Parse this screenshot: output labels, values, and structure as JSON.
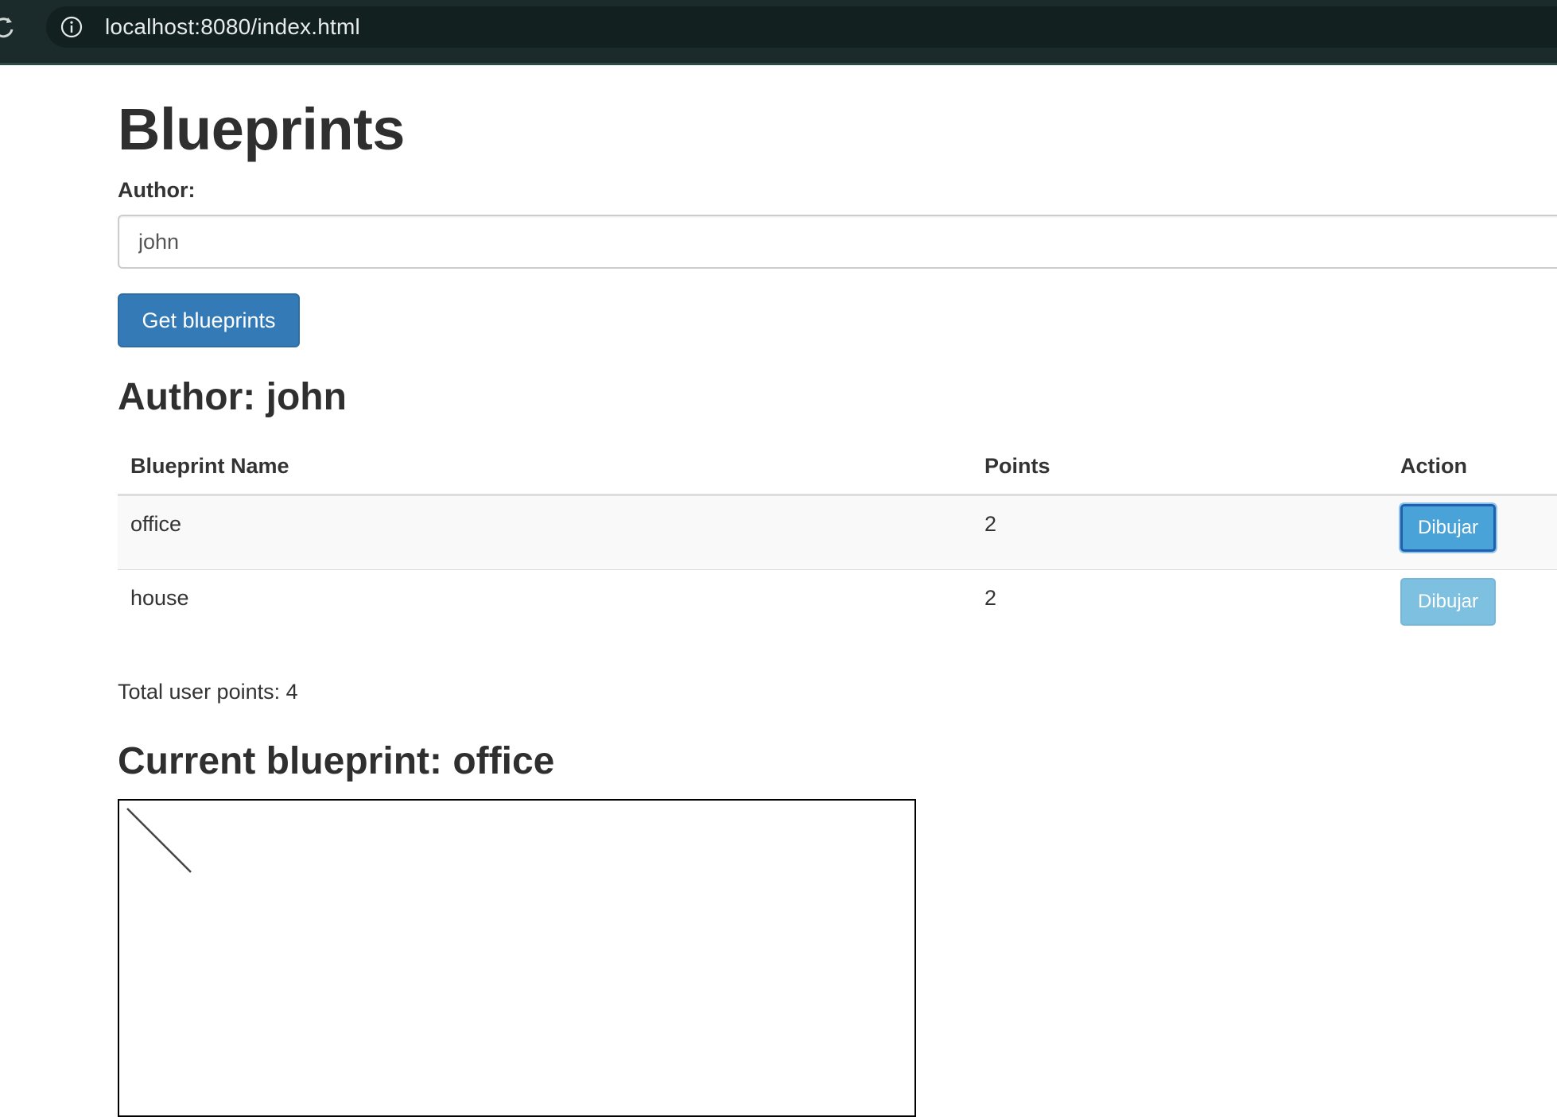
{
  "browser": {
    "url": "localhost:8080/index.html"
  },
  "page": {
    "title": "Blueprints",
    "author_label": "Author:",
    "author_input_value": "john",
    "get_button_label": "Get blueprints",
    "author_heading": "Author: john"
  },
  "table": {
    "headers": [
      "Blueprint Name",
      "Points",
      "Action"
    ],
    "rows": [
      {
        "name": "office",
        "points": "2",
        "action": "Dibujar",
        "active": true
      },
      {
        "name": "house",
        "points": "2",
        "action": "Dibujar",
        "active": false
      }
    ]
  },
  "summary": {
    "total_points_text": "Total user points: 4"
  },
  "current": {
    "heading": "Current blueprint: office"
  },
  "colors": {
    "primary_button": "#337ab7",
    "info_button": "#7ec0e0",
    "browser_bar": "#1b2a2a"
  },
  "icons": {
    "reload": "reload-icon",
    "info": "info-icon"
  }
}
